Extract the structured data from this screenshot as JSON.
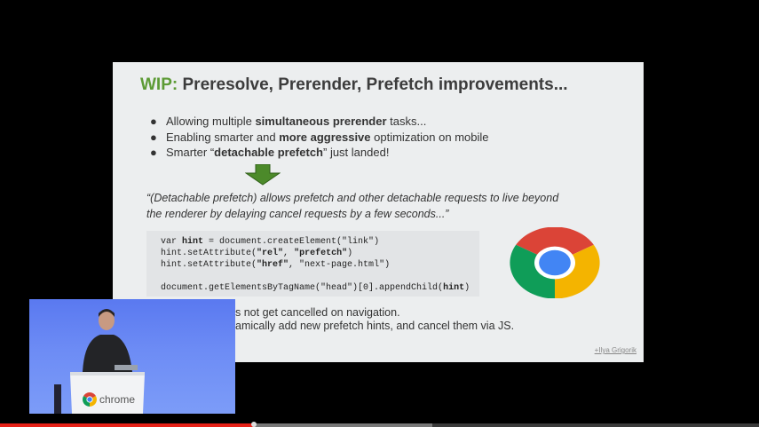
{
  "slide": {
    "title_prefix": "WIP:",
    "title_rest": "Preresolve, Prerender, Prefetch improvements...",
    "bullets": [
      {
        "before": "Allowing multiple ",
        "bold": "simultaneous prerender",
        "after": " tasks..."
      },
      {
        "before": "Enabling smarter and ",
        "bold": "more aggressive",
        "after": " optimization on mobile"
      },
      {
        "before": "Smarter “",
        "bold": "detachable prefetch",
        "after": "” just landed!"
      }
    ],
    "quote_line1": "“(Detachable prefetch) allows prefetch and other detachable requests to live beyond",
    "quote_line2": "the renderer by delaying cancel requests by a few seconds...”",
    "code": {
      "l1_a": "var ",
      "l1_b": "hint",
      "l1_c": " = document.createElement(\"link\")",
      "l2_a": "hint.setAttribute(",
      "l2_b": "\"rel\"",
      "l2_c": ", ",
      "l2_d": "\"prefetch\"",
      "l2_e": ")",
      "l3_a": "hint.setAttribute(",
      "l3_b": "\"href\"",
      "l3_c": ", \"next-page.html\")",
      "l4_a": "document.getElementsByTagName(\"head\")[0].appendChild(",
      "l4_b": "hint",
      "l4_c": ")"
    },
    "lower_line1": "s not get cancelled on navigation.",
    "lower_line2": "amically add new prefetch hints, and cancel them via JS.",
    "lower_link": "h",
    "author": "+Ilya Grigorik"
  },
  "speaker": {
    "podium_label": "chrome"
  },
  "progress": {
    "played": 0.335,
    "buffered": 0.57
  },
  "colors": {
    "wip_green": "#5d9b35",
    "arrow_green": "#4c8a2a",
    "progress_red": "#e62117"
  }
}
